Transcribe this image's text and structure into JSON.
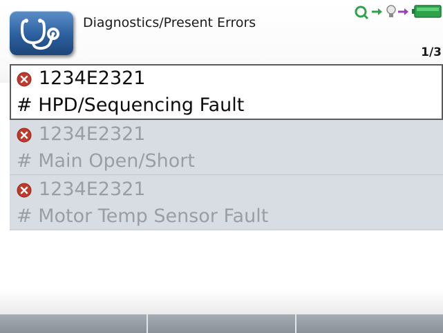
{
  "header": {
    "title": "Diagnostics/Present Errors",
    "page_indicator": "1/3",
    "app_icon": "stethoscope-icon",
    "status_icons": [
      "key-icon",
      "arrow-right-icon",
      "bulb-icon",
      "arrow-right-icon",
      "battery-icon"
    ]
  },
  "errors": [
    {
      "code": "1234E2321",
      "description": "# HPD/Sequencing Fault",
      "icon": "error-x-icon",
      "selected": true
    },
    {
      "code": "1234E2321",
      "description": "# Main Open/Short",
      "icon": "error-x-icon",
      "selected": false
    },
    {
      "code": "1234E2321",
      "description": "# Motor Temp Sensor Fault",
      "icon": "error-x-icon",
      "selected": false
    }
  ],
  "softkeys": [
    "",
    "",
    ""
  ],
  "colors": {
    "app_icon_blue": "#2c5f9e",
    "error_red": "#c0392b",
    "status_green": "#2ca24a",
    "row_background": "#d8dde4",
    "softkey_bar": "#9aa0a7"
  }
}
